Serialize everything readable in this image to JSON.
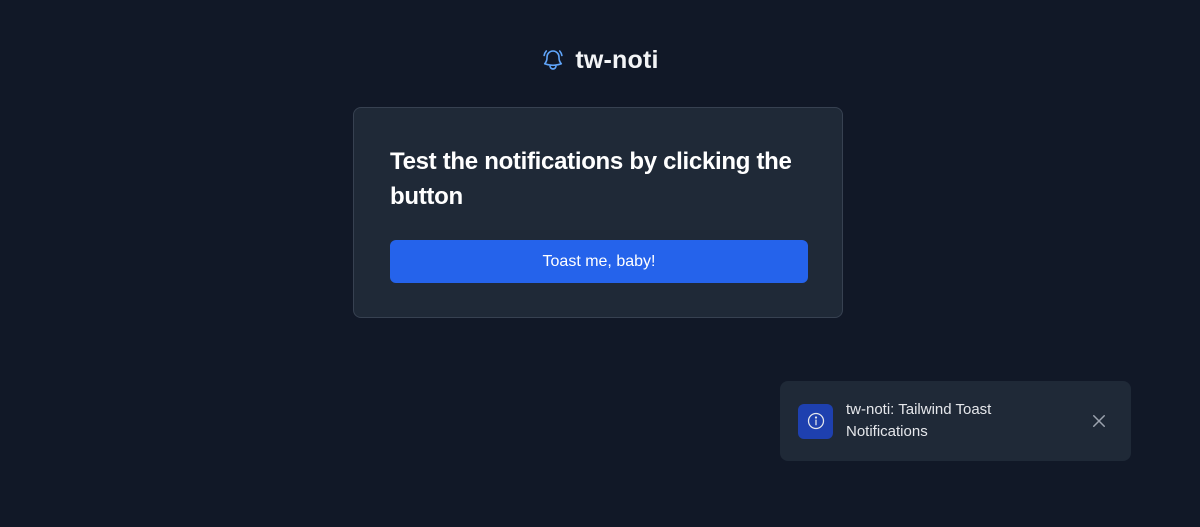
{
  "app": {
    "title": "tw-noti",
    "icon": "bell-icon",
    "accent_color": "#60a5fa"
  },
  "card": {
    "heading": "Test the notifications by clicking the button",
    "button_label": "Toast me, baby!",
    "button_color": "#2563eb"
  },
  "toast": {
    "icon": "info-icon",
    "message": "tw-noti: Tailwind Toast Notifications",
    "close_icon": "close-icon"
  }
}
